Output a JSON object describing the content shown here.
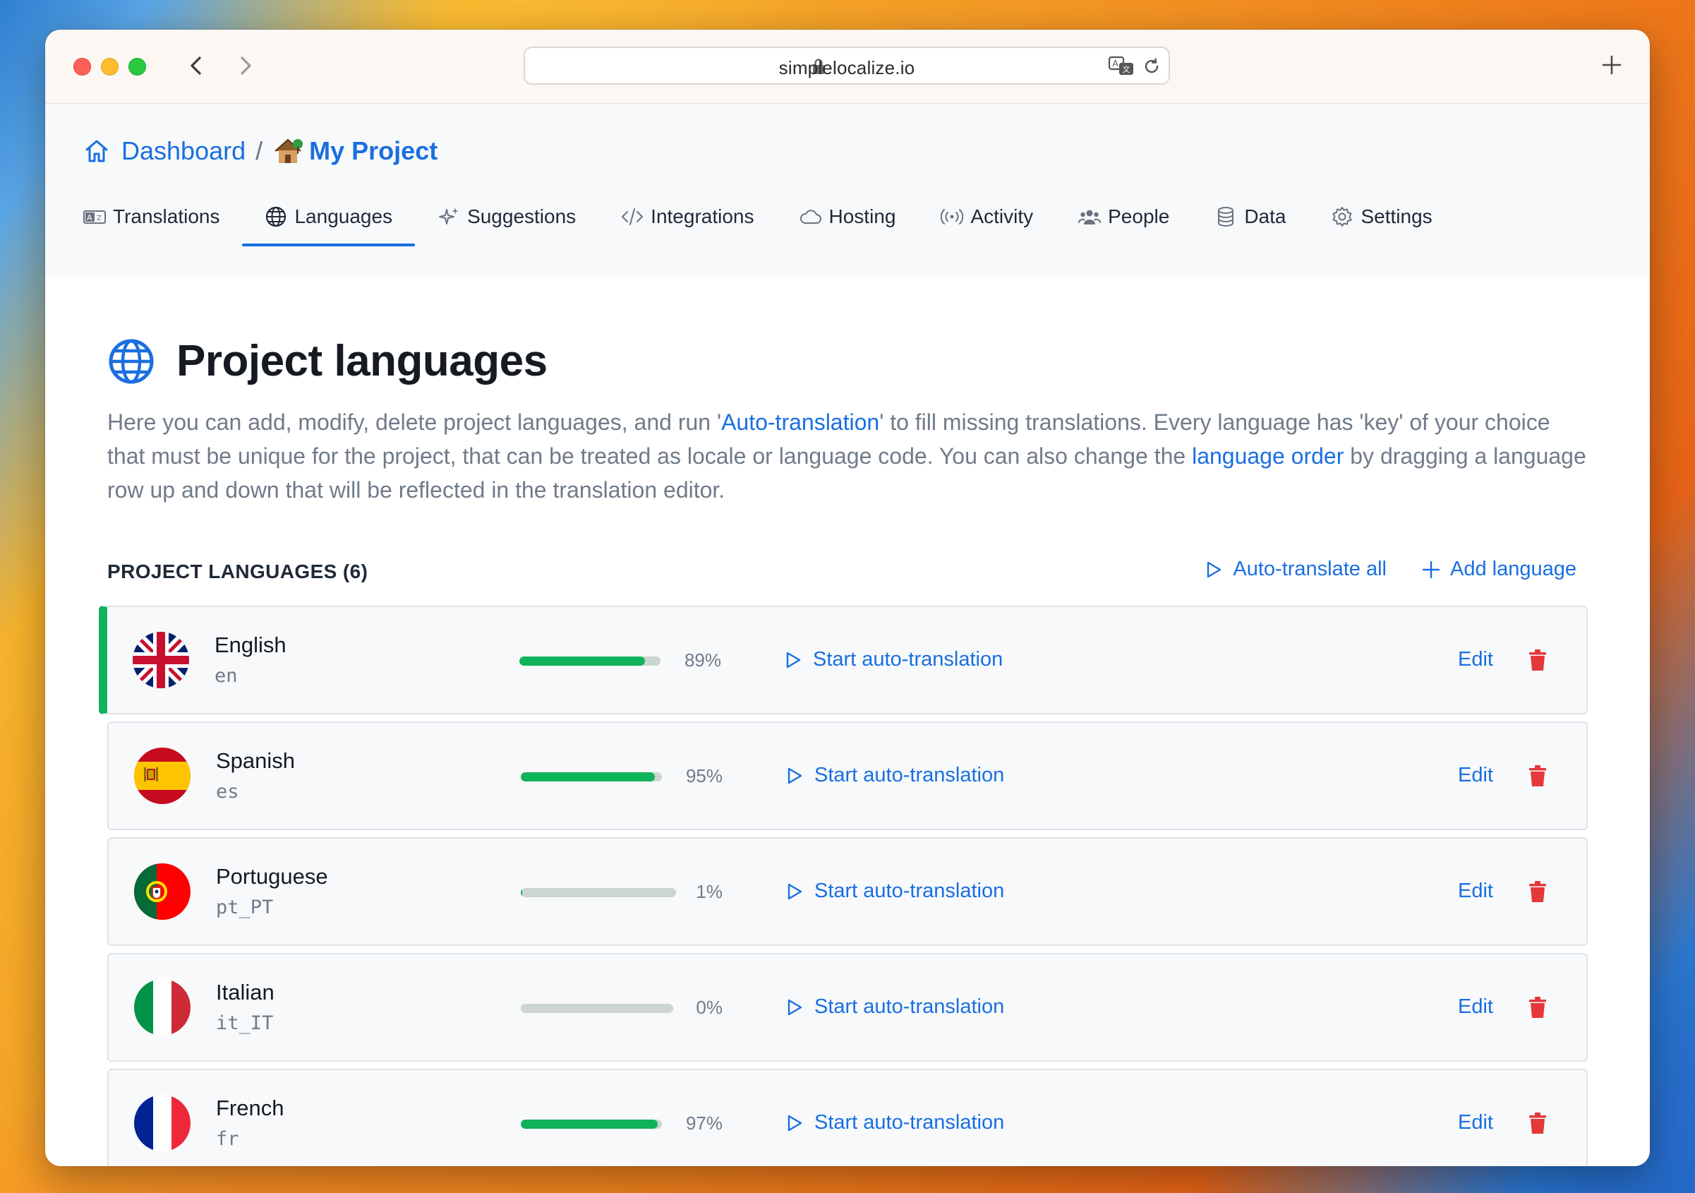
{
  "browser": {
    "url": "simplelocalize.io"
  },
  "breadcrumb": {
    "dashboard": "Dashboard",
    "separator": "/",
    "project": "My Project"
  },
  "tabs": [
    {
      "label": "Translations",
      "icon": "translations-icon",
      "active": false
    },
    {
      "label": "Languages",
      "icon": "globe-icon",
      "active": true
    },
    {
      "label": "Suggestions",
      "icon": "sparkles-icon",
      "active": false
    },
    {
      "label": "Integrations",
      "icon": "code-icon",
      "active": false
    },
    {
      "label": "Hosting",
      "icon": "cloud-icon",
      "active": false
    },
    {
      "label": "Activity",
      "icon": "broadcast-icon",
      "active": false
    },
    {
      "label": "People",
      "icon": "people-icon",
      "active": false
    },
    {
      "label": "Data",
      "icon": "database-icon",
      "active": false
    },
    {
      "label": "Settings",
      "icon": "gear-icon",
      "active": false
    }
  ],
  "page": {
    "title": "Project languages",
    "description_1": "Here you can add, modify, delete project languages, and run '",
    "description_link_1": "Auto-translation",
    "description_2": "' to fill missing translations. Every language has 'key' of your choice that must be unique for the project, that can be treated as locale or language code. You can also change the ",
    "description_link_2": "language order",
    "description_3": " by dragging a language row up and down that will be reflected in the translation editor."
  },
  "section": {
    "title": "PROJECT LANGUAGES (6)",
    "auto_translate_all": "Auto-translate all",
    "add_language": "Add language"
  },
  "row_actions": {
    "start_auto_translation": "Start auto-translation",
    "edit": "Edit"
  },
  "languages": [
    {
      "name": "English",
      "code": "en",
      "progress": 89,
      "progress_label": "89%",
      "flag": "uk-flag-icon",
      "selected": true
    },
    {
      "name": "Spanish",
      "code": "es",
      "progress": 95,
      "progress_label": "95%",
      "flag": "spain-flag-icon",
      "selected": false
    },
    {
      "name": "Portuguese",
      "code": "pt_PT",
      "progress": 1,
      "progress_label": "1%",
      "flag": "portugal-flag-icon",
      "selected": false
    },
    {
      "name": "Italian",
      "code": "it_IT",
      "progress": 0,
      "progress_label": "0%",
      "flag": "italy-flag-icon",
      "selected": false
    },
    {
      "name": "French",
      "code": "fr",
      "progress": 97,
      "progress_label": "97%",
      "flag": "france-flag-icon",
      "selected": false
    }
  ],
  "colors": {
    "accent": "#1a6fe0",
    "progress": "#0fb35a",
    "delete": "#e5383b"
  }
}
